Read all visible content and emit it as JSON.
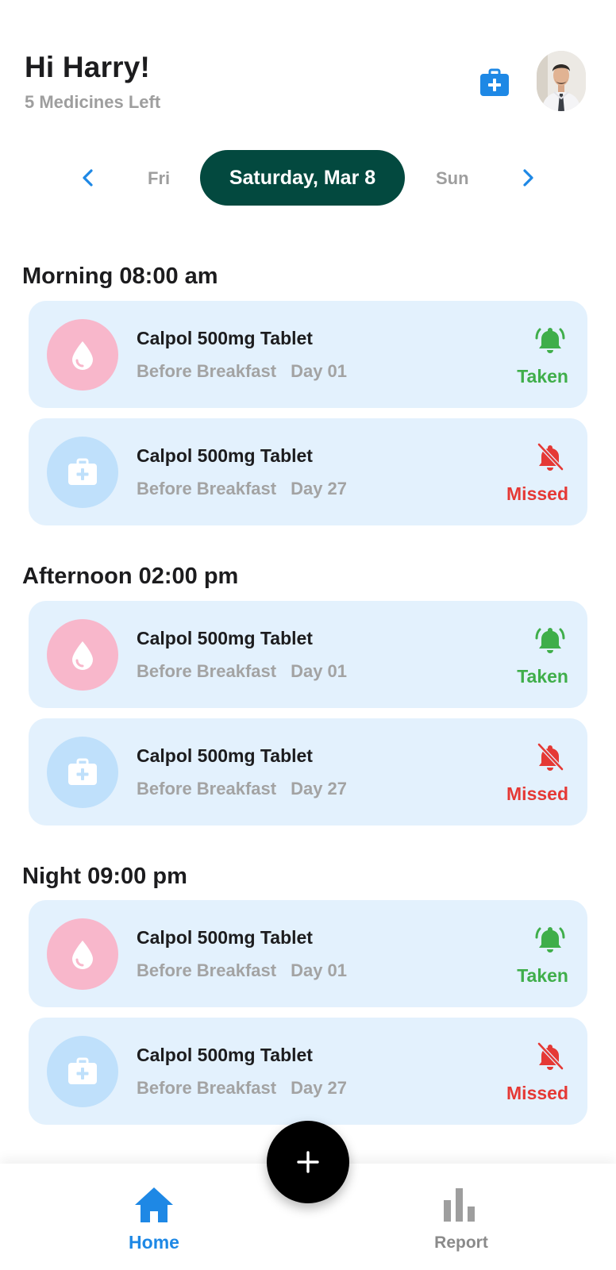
{
  "header": {
    "greeting": "Hi Harry!",
    "subtitle": "5 Medicines Left",
    "kit_icon": "medical-kit-icon",
    "avatar": "user-avatar-photo"
  },
  "date_selector": {
    "prev_icon": "chevron-left-icon",
    "next_icon": "chevron-right-icon",
    "previous_day": "Fri",
    "selected_day": "Saturday, Mar 8",
    "next_day": "Sun"
  },
  "schedule": [
    {
      "title": "Morning 08:00 am",
      "doses": [
        {
          "name": "Calpol 500mg Tablet",
          "timing": "Before Breakfast",
          "day": "Day 01",
          "status": "Taken",
          "icon": "drop-icon",
          "status_icon": "bell-ringing-icon"
        },
        {
          "name": "Calpol 500mg Tablet",
          "timing": "Before Breakfast",
          "day": "Day 27",
          "status": "Missed",
          "icon": "medical-kit-icon",
          "status_icon": "bell-off-icon"
        }
      ]
    },
    {
      "title": "Afternoon 02:00 pm",
      "doses": [
        {
          "name": "Calpol 500mg Tablet",
          "timing": "Before Breakfast",
          "day": "Day 01",
          "status": "Taken",
          "icon": "drop-icon",
          "status_icon": "bell-ringing-icon"
        },
        {
          "name": "Calpol 500mg Tablet",
          "timing": "Before Breakfast",
          "day": "Day 27",
          "status": "Missed",
          "icon": "medical-kit-icon",
          "status_icon": "bell-off-icon"
        }
      ]
    },
    {
      "title": "Night 09:00 pm",
      "doses": [
        {
          "name": "Calpol 500mg Tablet",
          "timing": "Before Breakfast",
          "day": "Day 01",
          "status": "Taken",
          "icon": "drop-icon",
          "status_icon": "bell-ringing-icon"
        },
        {
          "name": "Calpol 500mg Tablet",
          "timing": "Before Breakfast",
          "day": "Day 27",
          "status": "Missed",
          "icon": "medical-kit-icon",
          "status_icon": "bell-off-icon"
        }
      ]
    }
  ],
  "fab": {
    "icon": "plus-icon"
  },
  "bottom_nav": {
    "home_label": "Home",
    "home_icon": "home-icon",
    "report_label": "Report",
    "report_icon": "bar-chart-icon"
  },
  "colors": {
    "accent_blue": "#1e88e5",
    "selected_day_bg": "#03493f",
    "card_bg": "#e3f1fd",
    "taken_green": "#3fae4a",
    "missed_red": "#e53935",
    "drop_circle": "#f8b7cb",
    "kit_circle": "#bfe0fb"
  }
}
